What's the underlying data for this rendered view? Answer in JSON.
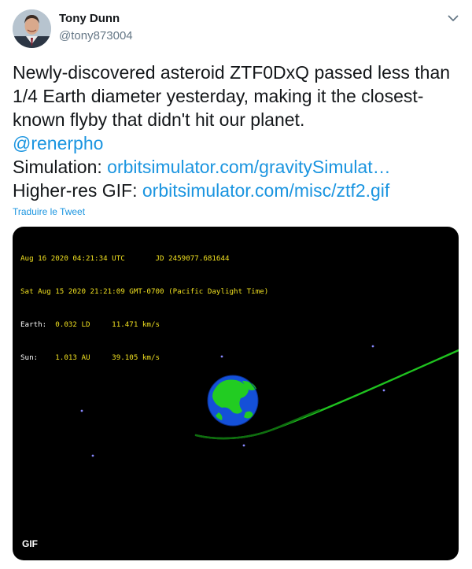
{
  "author": {
    "name": "Tony Dunn",
    "handle": "@tony873004"
  },
  "icons": {
    "menu": "chevron-down-icon",
    "avatar": "profile-photo"
  },
  "tweet": {
    "line1": "Newly-discovered asteroid ZTF0DxQ passed less than",
    "line2": "1/4 Earth diameter yesterday, making it the closest-",
    "line3": "known flyby that didn't hit our planet.",
    "mention": "@renerpho",
    "simulation_label": "Simulation: ",
    "simulation_link": "orbitsimulator.com/gravitySimulat…",
    "gif_label": "Higher-res GIF: ",
    "gif_link": "orbitsimulator.com/misc/ztf2.gif"
  },
  "translate_label": "Traduire le Tweet",
  "media": {
    "hud": {
      "utc": "Aug 16 2020 04:21:34 UTC       JD 2459077.681644",
      "local": "Sat Aug 15 2020 21:21:09 GMT-0700 (Pacific Daylight Time)",
      "earth_label": "Earth:",
      "earth_values": "  0.032 LD     11.471 km/s",
      "sun_label": "Sun:  ",
      "sun_values": "  1.013 AU     39.105 km/s"
    },
    "badge": "GIF"
  },
  "colors": {
    "link": "#1b95e0",
    "hud_text": "#f0e020",
    "trajectory": "#1fc21f",
    "earth_ocean": "#1450d8",
    "earth_land": "#22cc22",
    "media_bg": "#000000"
  }
}
